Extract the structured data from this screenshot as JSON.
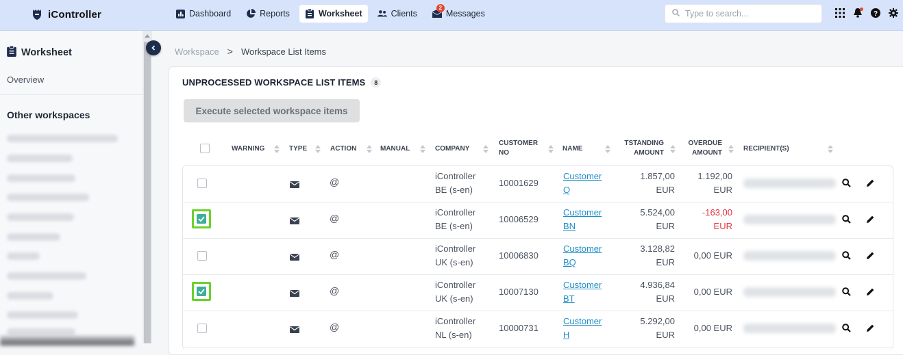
{
  "app": {
    "name": "iController"
  },
  "nav": [
    {
      "label": "Dashboard",
      "icon": "chart-icon",
      "active": false
    },
    {
      "label": "Reports",
      "icon": "pie-chart-icon",
      "active": false
    },
    {
      "label": "Worksheet",
      "icon": "clipboard-icon",
      "active": true
    },
    {
      "label": "Clients",
      "icon": "users-icon",
      "active": false
    },
    {
      "label": "Messages",
      "icon": "inbox-icon",
      "active": false,
      "badge": "2"
    }
  ],
  "search": {
    "placeholder": "Type to search..."
  },
  "sidebar": {
    "title": "Worksheet",
    "overview": "Overview",
    "other_title": "Other workspaces"
  },
  "breadcrumb": {
    "parent": "Workspace",
    "separator": ">",
    "current": "Workspace List Items"
  },
  "section": {
    "title": "UNPROCESSED WORKSPACE LIST ITEMS",
    "count": "8"
  },
  "execute_button": "Execute selected workspace items",
  "table": {
    "headers": {
      "warning": "WARNING",
      "type": "TYPE",
      "action": "ACTION",
      "manual": "MANUAL",
      "company": "COMPANY",
      "customer_no_1": "CUSTOMER",
      "customer_no_2": "NO",
      "name": "NAME",
      "outstanding_1": "TSTANDING",
      "outstanding_2": "AMOUNT",
      "overdue_1": "OVERDUE",
      "overdue_2": "AMOUNT",
      "recipients": "RECIPIENT(S)"
    },
    "rows": [
      {
        "checked": false,
        "action": "@",
        "company_1": "iController",
        "company_2": "BE (s-en)",
        "customer_no": "10001629",
        "name_1": "Customer",
        "name_2": "Q",
        "outstanding_1": "1.857,00",
        "outstanding_2": "EUR",
        "overdue_1": "1.192,00",
        "overdue_2": "EUR",
        "overdue_negative": false
      },
      {
        "checked": true,
        "action": "@",
        "company_1": "iController",
        "company_2": "BE (s-en)",
        "customer_no": "10006529",
        "name_1": "Customer",
        "name_2": "BN",
        "outstanding_1": "5.524,00",
        "outstanding_2": "EUR",
        "overdue_1": "-163,00",
        "overdue_2": "EUR",
        "overdue_negative": true
      },
      {
        "checked": false,
        "action": "@",
        "company_1": "iController",
        "company_2": "UK (s-en)",
        "customer_no": "10006830",
        "name_1": "Customer",
        "name_2": "BQ",
        "outstanding_1": "3.128,82",
        "outstanding_2": "EUR",
        "overdue_1": "0,00 EUR",
        "overdue_2": "",
        "overdue_negative": false
      },
      {
        "checked": true,
        "action": "@",
        "company_1": "iController",
        "company_2": "UK (s-en)",
        "customer_no": "10007130",
        "name_1": "Customer",
        "name_2": "BT",
        "outstanding_1": "4.936,84",
        "outstanding_2": "EUR",
        "overdue_1": "0,00 EUR",
        "overdue_2": "",
        "overdue_negative": false
      },
      {
        "checked": false,
        "action": "@",
        "company_1": "iController",
        "company_2": "NL (s-en)",
        "customer_no": "10000731",
        "name_1": "Customer",
        "name_2": "H",
        "outstanding_1": "5.292,00",
        "outstanding_2": "EUR",
        "overdue_1": "0,00 EUR",
        "overdue_2": "",
        "overdue_negative": false
      }
    ]
  },
  "colors": {
    "topbar": "#d7e3fb",
    "link": "#1f8ec9",
    "negative": "#e8323c",
    "highlight": "#6ad22a",
    "checkbox_fill": "#3eae9a"
  }
}
